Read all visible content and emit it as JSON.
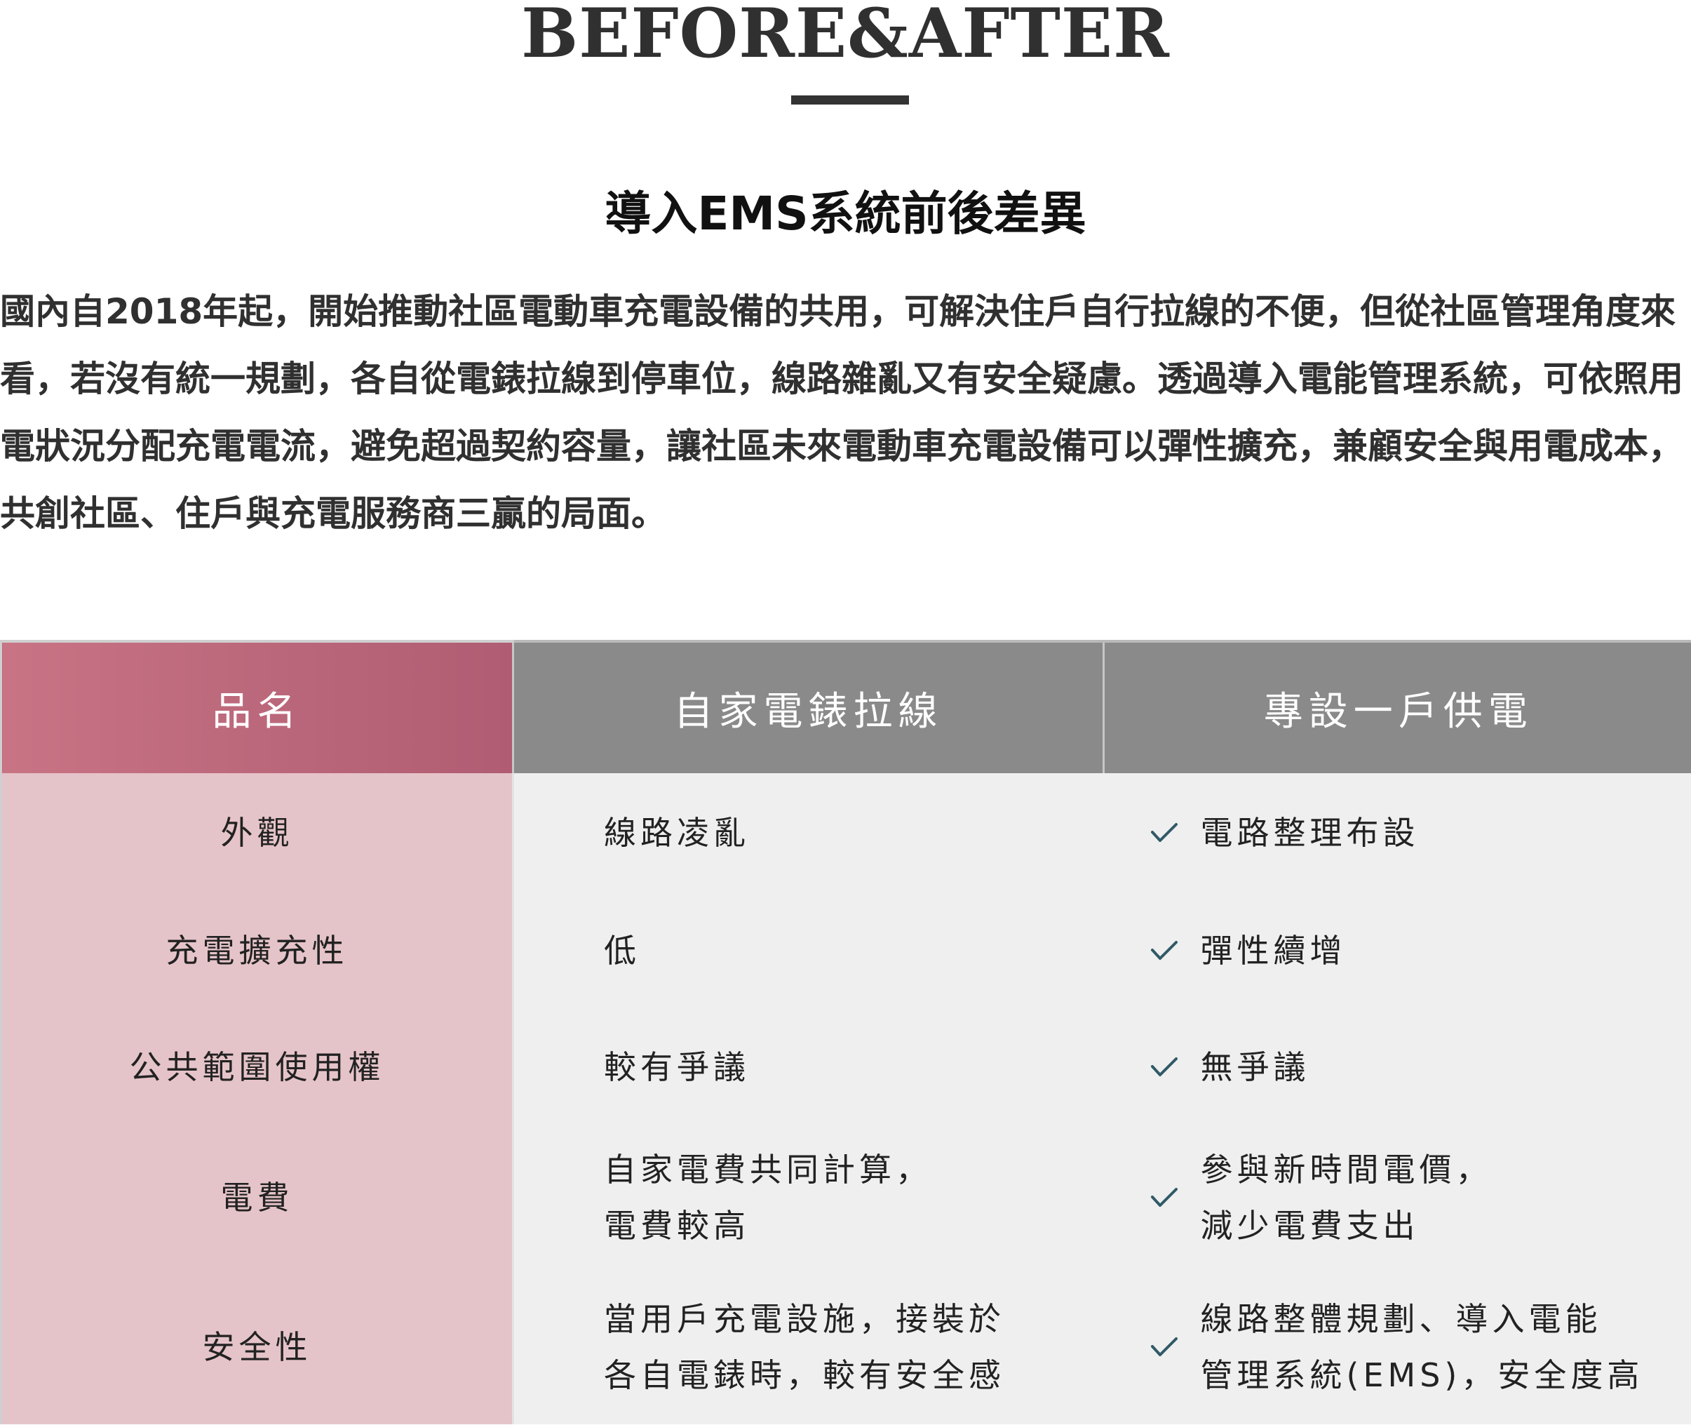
{
  "header": {
    "title": "BEFORE&AFTER"
  },
  "section": {
    "title": "導入EMS系統前後差異",
    "intro": "國內自2018年起，開始推動社區電動車充電設備的共用，可解決住戶自行拉線的不便，但從社區管理角度來看，若沒有統一規劃，各自從電錶拉線到停車位，線路雜亂又有安全疑慮。透過導入電能管理系統，可依照用電狀況分配充電電流，避免超過契約容量，讓社區未來電動車充電設備可以彈性擴充，兼顧安全與用電成本，共創社區、住戶與充電服務商三贏的局面。"
  },
  "table": {
    "headers": {
      "name": "品名",
      "diy": "自家電錶拉線",
      "dedicated": "專設一戶供電"
    },
    "rows": [
      {
        "name": "外觀",
        "diy": [
          "線路凌亂"
        ],
        "dedicated": [
          "電路整理布設"
        ]
      },
      {
        "name": "充電擴充性",
        "diy": [
          "低"
        ],
        "dedicated": [
          "彈性續增"
        ]
      },
      {
        "name": "公共範圍使用權",
        "diy": [
          "較有爭議"
        ],
        "dedicated": [
          "無爭議"
        ]
      },
      {
        "name": "電費",
        "diy": [
          "自家電費共同計算，",
          "電費較高"
        ],
        "dedicated": [
          "參與新時間電價，",
          "減少電費支出"
        ]
      },
      {
        "name": "安全性",
        "diy": [
          "當用戶充電設施，接裝於",
          "各自電錶時，較有安全感"
        ],
        "dedicated": [
          "線路整體規劃、導入電能",
          "管理系統(EMS)，安全度高"
        ]
      }
    ],
    "check_icon": "checkmark-icon",
    "colors": {
      "header_name_start": "#c87485",
      "header_name_end": "#b05c72",
      "header_gray": "#8a8a8a",
      "name_column": "#e5c4c9",
      "body_gray": "#efefef",
      "check": "#2f5a66"
    }
  }
}
